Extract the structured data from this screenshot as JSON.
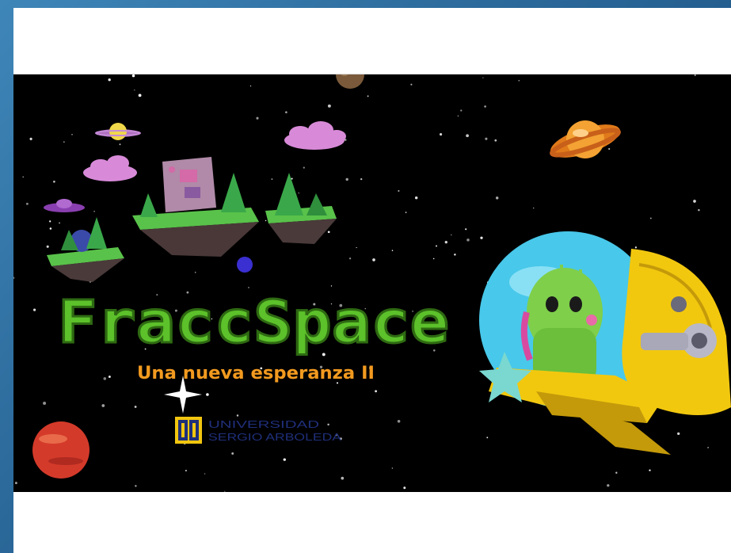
{
  "game": {
    "title": "FraccSpace",
    "subtitle": "Una nueva esperanza II"
  },
  "logo": {
    "line1": "UNIVERSIDAD",
    "line2": "SERGIO ARBOLEDA"
  },
  "colors": {
    "page_background": "#2d6c9d",
    "panel_background": "#ffffff",
    "space": "#000000",
    "title_green": "#5cc12a",
    "title_outline": "#2e6a12",
    "subtitle_orange": "#f29a1f",
    "logo_navy": "#1f2f7a",
    "logo_yellow": "#f2c60f"
  },
  "icons": [
    "planet-icon",
    "saturn-icon",
    "ufo-icon",
    "cloud-icon",
    "tree-icon",
    "house-icon",
    "rocket-icon",
    "android-astronaut-icon",
    "star-icon",
    "university-shield-icon"
  ]
}
